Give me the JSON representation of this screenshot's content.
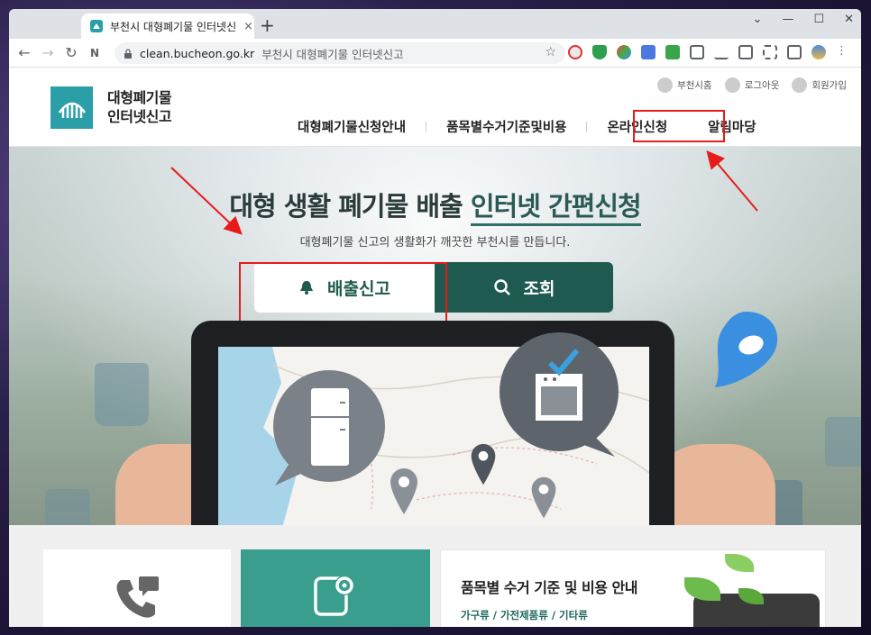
{
  "browser": {
    "tab_title": "부천시 대형폐기물 인터넷신고",
    "tab_close": "×",
    "new_tab": "+",
    "url": "clean.bucheon.go.kr",
    "url_page_title": "부천시 대형폐기물 인터넷신고",
    "window_controls": [
      "⌄",
      "—",
      "☐",
      "✕"
    ]
  },
  "site": {
    "logo_line1": "대형폐기물",
    "logo_line2": "인터넷신고",
    "util_links": [
      "부천시홈",
      "로그아웃",
      "회원가입"
    ],
    "nav": [
      "대형폐기물신청안내",
      "품목별수거기준및비용",
      "온라인신청",
      "알림마당"
    ]
  },
  "hero": {
    "title_plain": "대형 생활 폐기물 배출 ",
    "title_underlined": "인터넷 간편신청",
    "subtitle": "대형폐기물 신고의 생활화가 깨끗한 부천시를 만듭니다.",
    "report_button": "배출신고",
    "search_button": "조회"
  },
  "bottom": {
    "card3_title": "품목별 수거 기준 및 비용 안내",
    "card3_sub": "가구류 / 가전제품류 / 기타류"
  },
  "colors": {
    "brand_teal": "#2a9fa8",
    "brand_green": "#1e5a4f",
    "highlight_red": "#e81b1b"
  }
}
